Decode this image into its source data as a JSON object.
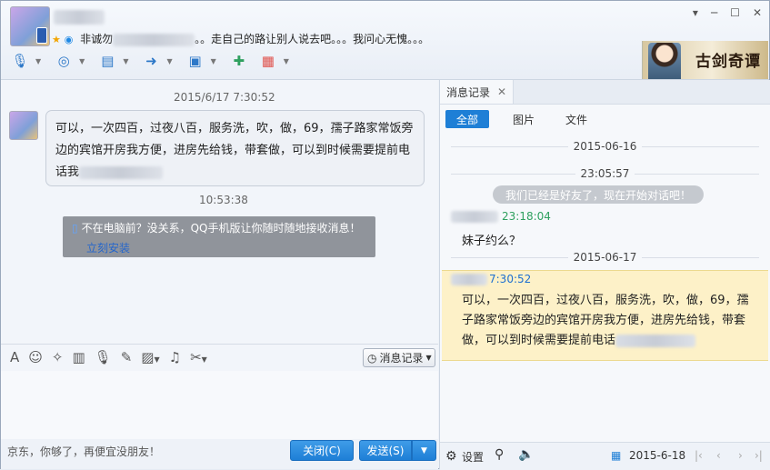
{
  "header": {
    "signature": "。。走自己的路让别人说去吧。。。我问心无愧。。。",
    "signature_prefix": "非诚勿",
    "window_buttons": [
      "▾",
      "─",
      "☐",
      "✕"
    ],
    "banner_title": "古剑奇谭"
  },
  "toolbar": {
    "icons": [
      "microphone-icon",
      "camera-icon",
      "screen-share-icon",
      "file-transfer-icon",
      "remote-desktop-icon",
      "add-chat-icon",
      "apps-icon"
    ]
  },
  "chat": {
    "timestamp1": "2015/6/17 7:30:52",
    "message1_lines": [
      "可以，一次四百，过夜八百，服务洗，吹，做，69，孺子路家常饭旁",
      "边的宾馆开房我方便，进房先给钱，带套做，可以到时候需要提前电",
      "话我"
    ],
    "timestamp2": "10:53:38",
    "notice_text": "不在电脑前？没关系，QQ手机版让你随时随地接收消息！",
    "notice_link": "立刻安装"
  },
  "input_toolbar": {
    "history_label": "消息记录"
  },
  "bottom": {
    "ad_text": "京东，你够了，再便宜没朋友！",
    "close_label": "关闭(C)",
    "send_label": "发送(S)"
  },
  "history": {
    "tab_label": "消息记录",
    "filters": [
      "全部",
      "图片",
      "文件"
    ],
    "date1": "2015-06-16",
    "time1": "23:05:57",
    "system_msg": "我们已经是好友了，现在开始对话吧！",
    "time2": "23:18:04",
    "msg2": "妹子约么？",
    "date2": "2015-06-17",
    "time3": "7:30:52",
    "msg3": "可以，一次四百，过夜八百，服务洗，吹，做，69，孺子路家常饭旁边的宾馆开房我方便，进房先给钱，带套做，可以到时候需要提前电话",
    "settings_label": "设置",
    "date_field": "2015-6-18"
  }
}
